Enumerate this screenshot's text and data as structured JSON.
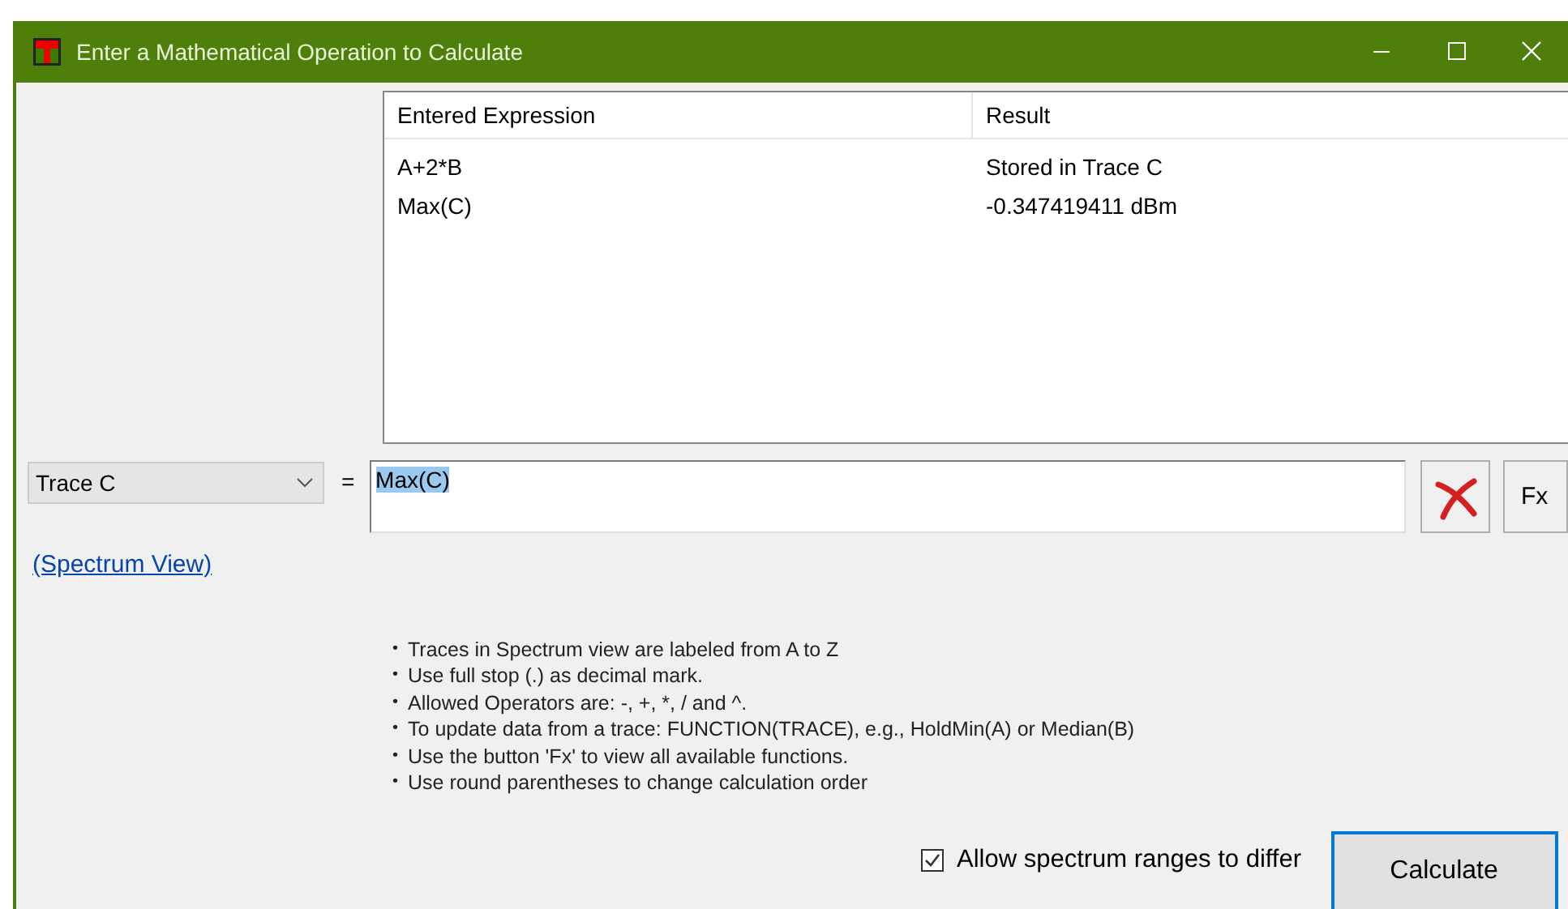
{
  "window": {
    "title": "Enter a Mathematical Operation to Calculate"
  },
  "table": {
    "columns": [
      "Entered Expression",
      "Result"
    ],
    "rows": [
      {
        "expression": "A+2*B",
        "result": "Stored in Trace C"
      },
      {
        "expression": "Max(C)",
        "result": "-0.347419411 dBm"
      }
    ]
  },
  "trace_select": {
    "value": "Trace C"
  },
  "equals": "=",
  "expression_field": {
    "value": "Max(C)",
    "selected": true
  },
  "fx_button": "Fx",
  "link": "(Spectrum View)",
  "hints": [
    "Traces in Spectrum view are labeled from A to Z",
    "Use full stop (.) as decimal mark.",
    "Allowed Operators are: -, +, *, / and ^.",
    "To update data from a trace: FUNCTION(TRACE), e.g., HoldMin(A) or Median(B)",
    "Use the button 'Fx' to view all available functions.",
    "Use round parentheses to change calculation order"
  ],
  "bullet": "•",
  "allow_ranges": {
    "label": "Allow spectrum ranges to differ",
    "checked": true
  },
  "calculate_button": "Calculate"
}
